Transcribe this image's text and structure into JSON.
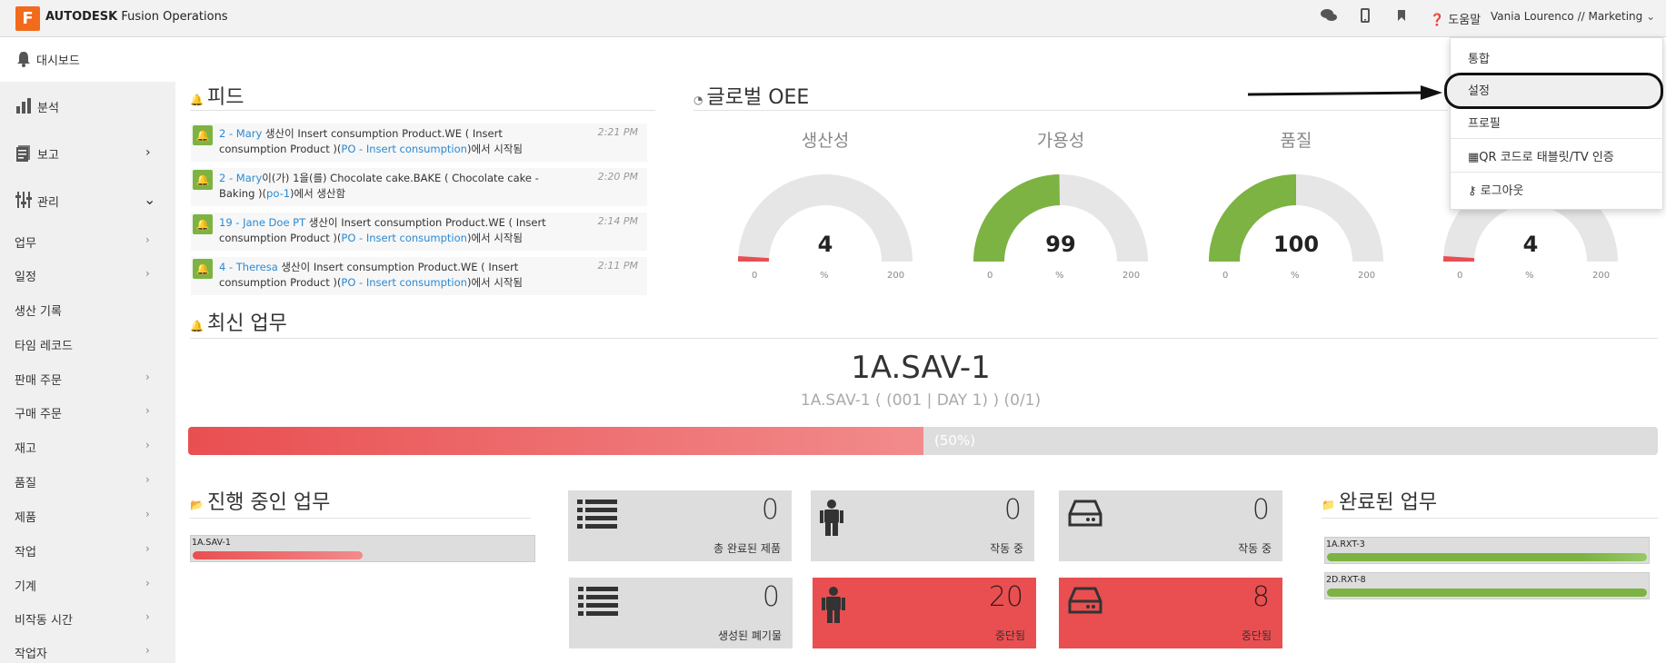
{
  "header": {
    "logo_letter": "F",
    "brand": "AUTODESK",
    "product": "Fusion Operations",
    "help_label": "도움말",
    "user_label": "Vania Lourenco // Marketing"
  },
  "icons": {
    "chat": "chat-icon",
    "mobile": "mobile-icon",
    "bookmark": "bookmark-icon",
    "help": "help-icon",
    "chevron": "chevron-down-icon"
  },
  "sidebar": {
    "dashboard": "대시보드",
    "top_items": [
      {
        "label": "분석",
        "icon": "analytics-icon"
      },
      {
        "label": "보고",
        "icon": "report-icon"
      },
      {
        "label": "관리",
        "icon": "manage-icon"
      }
    ],
    "items": [
      "업무",
      "일정",
      "생산 기록",
      "타임 레코드",
      "판매 주문",
      "구매 주문",
      "재고",
      "품질",
      "제품",
      "작업",
      "기계",
      "비작동 시간",
      "작업자"
    ]
  },
  "feed": {
    "title": "피드",
    "items": [
      {
        "who": "2 - Mary",
        "text1": " 생산이 Insert consumption Product.WE ( Insert consumption Product )(",
        "link": "PO - Insert consumption",
        "text2": ")에서 시작됨",
        "time": "2:21 PM"
      },
      {
        "who": "2 - Mary",
        "text1": "이(가) 1을(를) Chocolate cake.BAKE ( Chocolate cake - Baking )(",
        "link": "po-1",
        "text2": ")에서 생산함",
        "time": "2:20 PM"
      },
      {
        "who": "19 - Jane Doe PT",
        "text1": " 생산이 Insert consumption Product.WE ( Insert consumption Product )(",
        "link": "PO - Insert consumption",
        "text2": ")에서 시작됨",
        "time": "2:14 PM"
      },
      {
        "who": "4 - Theresa",
        "text1": " 생산이 Insert consumption Product.WE ( Insert consumption Product )(",
        "link": "PO - Insert consumption",
        "text2": ")에서 시작됨",
        "time": "2:11 PM"
      }
    ]
  },
  "oee": {
    "title": "글로벌 OEE",
    "gauges": [
      {
        "label": "생산성",
        "value": 4,
        "unit": "%",
        "min": "0",
        "max": "200",
        "color": "#e94f51"
      },
      {
        "label": "가용성",
        "value": 99,
        "unit": "%",
        "min": "0",
        "max": "200",
        "color": "#7cb342"
      },
      {
        "label": "품질",
        "value": 100,
        "unit": "%",
        "min": "0",
        "max": "200",
        "color": "#7cb342"
      },
      {
        "label": "",
        "value": 4,
        "unit": "%",
        "min": "0",
        "max": "200",
        "color": "#e94f51"
      }
    ]
  },
  "latest": {
    "title": "최신 업무",
    "job": "1A.SAV-1",
    "job_sub": "1A.SAV-1 ( (001 | DAY 1) ) (0/1)",
    "progress": 0.5,
    "progress_text": "(50%)"
  },
  "in_progress": {
    "title": "진행 중인 업무",
    "jobs": [
      {
        "name": "1A.SAV-1",
        "progress": 0.5
      }
    ]
  },
  "tiles": [
    {
      "value": "0",
      "label": "총 완료된 제품",
      "icon": "list-icon",
      "red": false
    },
    {
      "value": "0",
      "label": "작동 중",
      "icon": "worker-icon",
      "red": false
    },
    {
      "value": "0",
      "label": "작동 중",
      "icon": "machine-icon",
      "red": false
    },
    {
      "value": "0",
      "label": "생성된 폐기물",
      "icon": "list-icon",
      "red": false
    },
    {
      "value": "20",
      "label": "중단됨",
      "icon": "worker-icon",
      "red": true
    },
    {
      "value": "8",
      "label": "중단됨",
      "icon": "machine-icon",
      "red": true
    }
  ],
  "completed": {
    "title": "완료된 업무",
    "jobs": [
      {
        "name": "1A.RXT-3",
        "progress": 1.0
      },
      {
        "name": "2D.RXT-8",
        "progress": 1.0
      }
    ]
  },
  "dropdown": {
    "items": [
      "통합",
      "설정",
      "프로필",
      "QR 코드로 태블릿/TV 인증",
      "로그아웃"
    ]
  }
}
